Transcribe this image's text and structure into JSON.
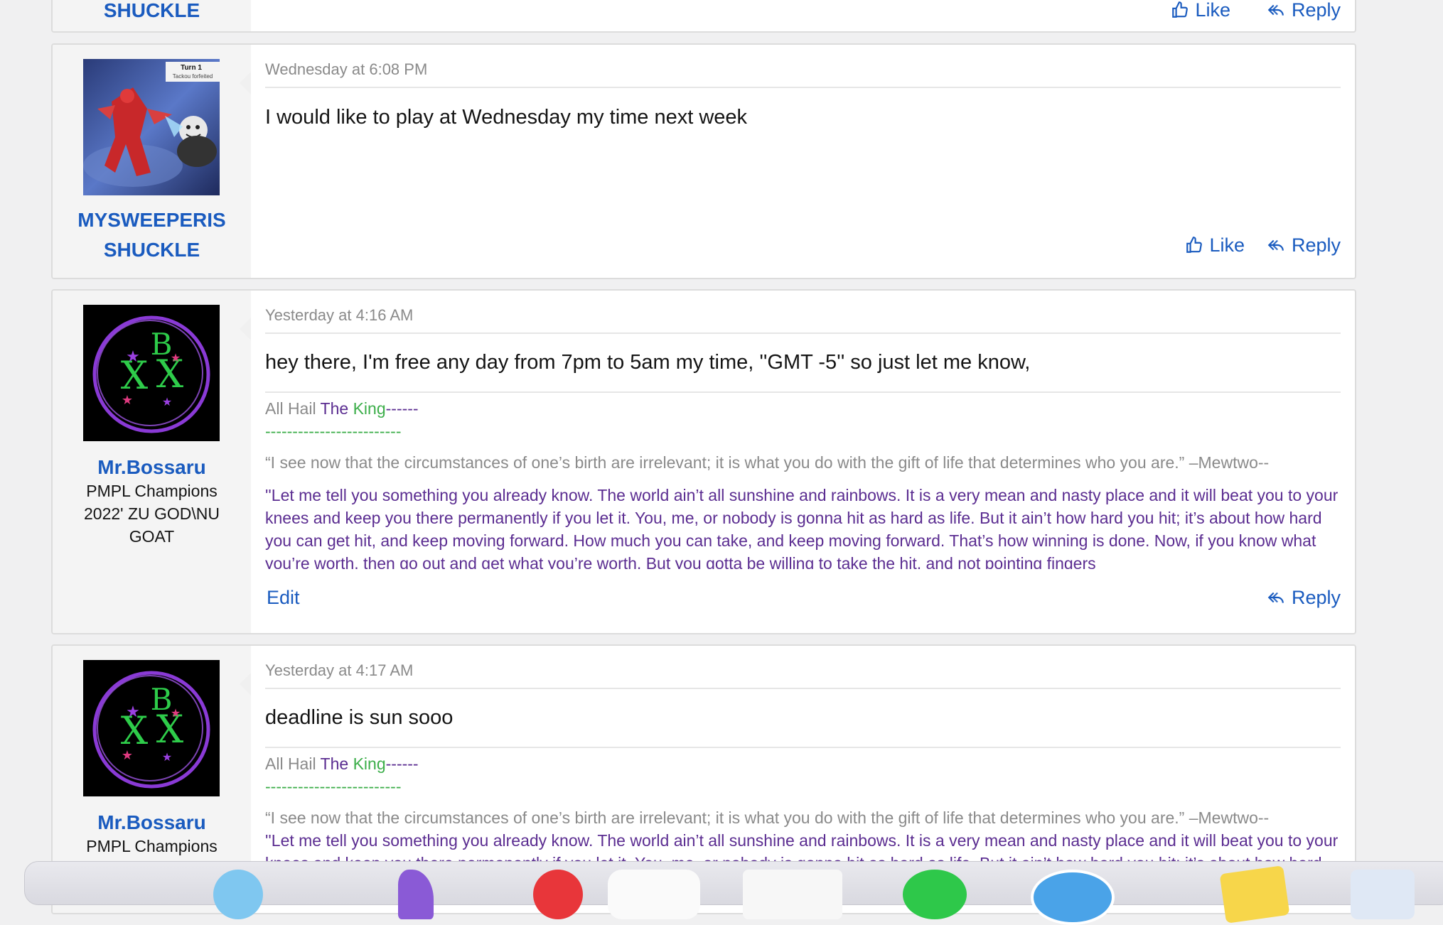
{
  "top_post": {
    "username_tail": "SHUCKLE",
    "like_label": "Like",
    "reply_label": "Reply"
  },
  "posts": [
    {
      "date": "Wednesday at 6:08 PM",
      "username_line1": "MYSWEEPERIS",
      "username_line2": "SHUCKLE",
      "avatar_caption_1": "Turn 1",
      "avatar_caption_2": "Tackou forfeited",
      "message": "I would like to play at Wednesday my time next week",
      "like_label": "Like",
      "reply_label": "Reply"
    },
    {
      "date": "Yesterday at 4:16 AM",
      "username": "Mr.Bossaru",
      "user_title": "PMPL Champions 2022' ZU GOD\\NU GOAT",
      "message": "hey there, I'm free any day from 7pm to 5am my time, ''GMT -5'' so just let me know,",
      "edit_label": "Edit",
      "reply_label": "Reply"
    },
    {
      "date": "Yesterday at 4:17 AM",
      "username": "Mr.Bossaru",
      "user_title": "PMPL Champions",
      "message": "deadline is sun sooo"
    }
  ],
  "signature": {
    "hail": "All Hail ",
    "the": "The ",
    "king": "King",
    "dashes": "------",
    "green_line": "-------------------------",
    "quote1": "“I see now that the circumstances of one’s birth are irrelevant; it is what you do with the gift of life that determines who you are.” –Mewtwo--",
    "quote2": "''Let me tell you something you already know. The world ain’t all sunshine and rainbows. It is a very mean and nasty place and it will beat you to your knees and keep you there permanently if you let it. You, me, or nobody is gonna hit as hard as life. But it ain’t how hard you hit; it’s about how hard you can get hit, and keep moving forward. How much you can take, and keep moving forward. That’s how winning is done. Now, if you know what you’re worth, then go out and get what you’re worth. But you gotta be willing to take the hit, and not pointing fingers"
  },
  "colors": {
    "link": "#1a5bbf",
    "sig_purple": "#5b2d91",
    "sig_green": "#3cae4a",
    "muted": "#8a8a8a"
  }
}
